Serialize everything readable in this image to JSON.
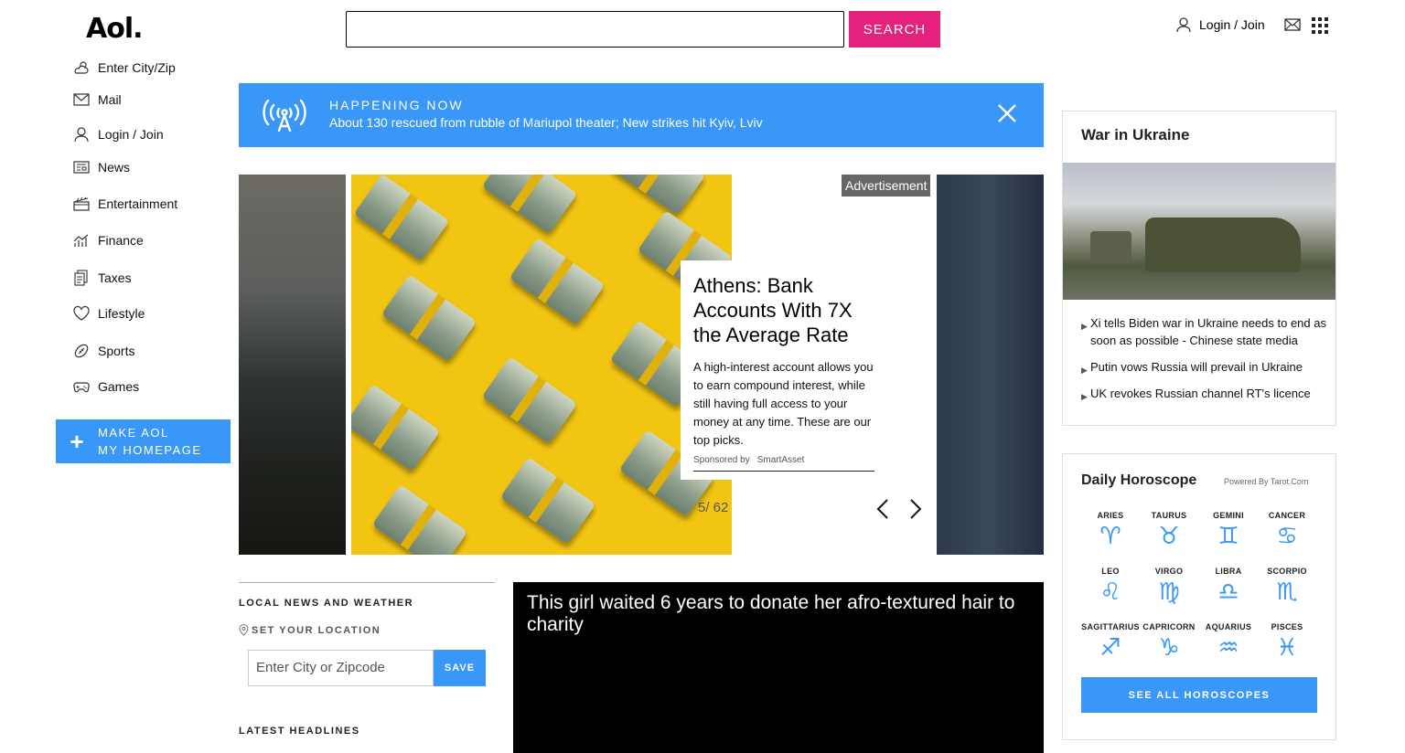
{
  "header": {
    "logo": "Aol.",
    "search_placeholder": "",
    "search_button": "SEARCH",
    "login_label": "Login / Join"
  },
  "sidebar": {
    "items": [
      {
        "label": "Enter City/Zip",
        "icon": "weather-icon"
      },
      {
        "label": "Mail",
        "icon": "mail-icon"
      },
      {
        "label": "Login / Join",
        "icon": "user-icon"
      },
      {
        "label": "News",
        "icon": "news-icon"
      },
      {
        "label": "Entertainment",
        "icon": "clapperboard-icon"
      },
      {
        "label": "Finance",
        "icon": "finance-chart-icon"
      },
      {
        "label": "Taxes",
        "icon": "taxes-document-icon"
      },
      {
        "label": "Lifestyle",
        "icon": "heart-icon"
      },
      {
        "label": "Sports",
        "icon": "football-icon"
      },
      {
        "label": "Games",
        "icon": "gamepad-icon"
      }
    ],
    "make_homepage_line1": "MAKE AOL",
    "make_homepage_line2": "MY HOMEPAGE"
  },
  "happening": {
    "title": "HAPPENING NOW",
    "headline": "About 130 rescued from rubble of Mariupol theater; New strikes hit Kyiv, Lviv"
  },
  "carousel": {
    "ad_tag": "Advertisement",
    "ad_title": "Athens: Bank Accounts With 7X the Average Rate",
    "ad_description": "A high-interest account allows you to earn compound interest, while still having full access to your money at any time. These are our top picks.",
    "sponsored_by": "Sponsored by",
    "sponsor": "SmartAsset",
    "slide_counter": "5/ 62"
  },
  "local": {
    "heading": "LOCAL NEWS AND WEATHER",
    "set_location": "SET YOUR LOCATION",
    "zip_placeholder": "Enter City or Zipcode",
    "save": "SAVE",
    "latest": "LATEST HEADLINES"
  },
  "video": {
    "title": "This girl waited 6 years to donate her afro-textured hair to charity"
  },
  "ukraine": {
    "title": "War in Ukraine",
    "headlines": [
      "Xi tells Biden war in Ukraine needs to end as soon as possible - Chinese state media",
      "Putin vows Russia will prevail in Ukraine",
      "UK revokes Russian channel RT's licence"
    ]
  },
  "horoscope": {
    "title": "Daily Horoscope",
    "powered_by": "Powered By Tarot.Com",
    "signs": [
      "ARIES",
      "TAURUS",
      "GEMINI",
      "CANCER",
      "LEO",
      "VIRGO",
      "LIBRA",
      "SCORPIO",
      "SAGITTARIUS",
      "CAPRICORN",
      "AQUARIUS",
      "PISCES"
    ],
    "glyphs": [
      "♈",
      "♉",
      "♊",
      "♋",
      "♌",
      "♍",
      "♎",
      "♏",
      "♐",
      "♑",
      "♒",
      "♓"
    ],
    "button": "SEE ALL HOROSCOPES"
  },
  "colors": {
    "accent_blue": "#3997f8",
    "search_pink": "#e5217e",
    "ad_yellow": "#f3c513"
  }
}
